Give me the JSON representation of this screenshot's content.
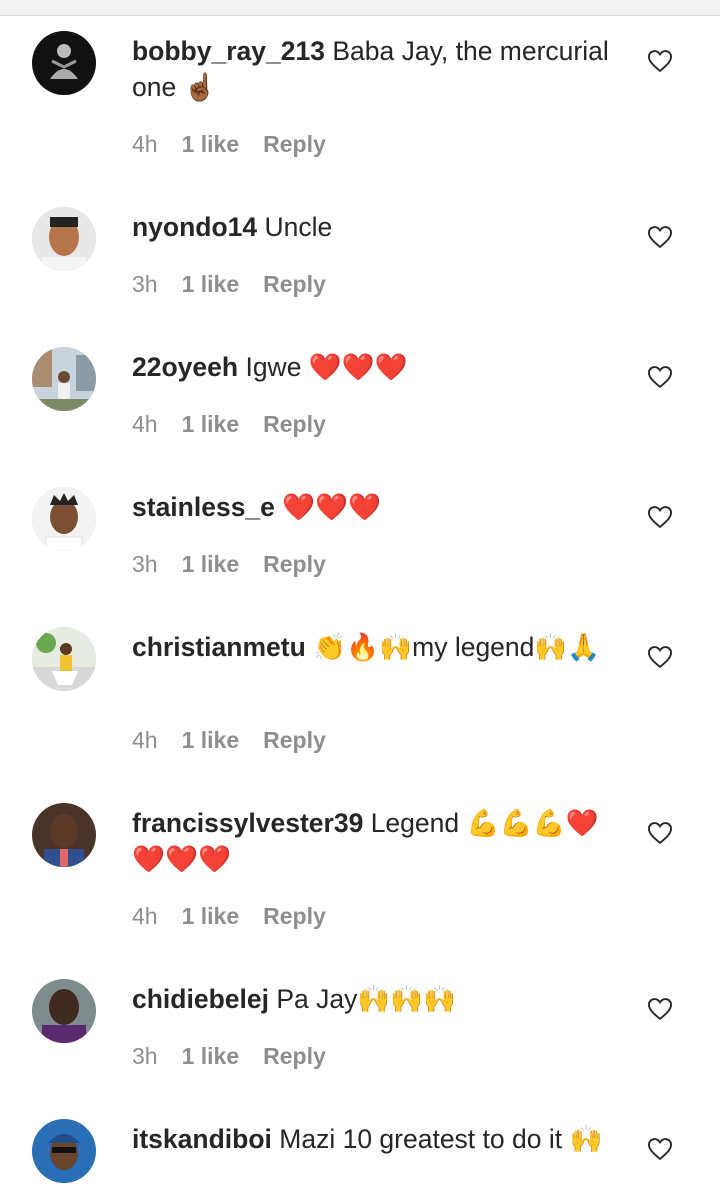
{
  "comments": [
    {
      "username": "bobby_ray_213",
      "text": "Baba Jay, the mercurial one ☝🏾",
      "time": "4h",
      "likes": "1 like",
      "reply": "Reply"
    },
    {
      "username": "nyondo14",
      "text": "Uncle",
      "time": "3h",
      "likes": "1 like",
      "reply": "Reply"
    },
    {
      "username": "22oyeeh",
      "text": "Igwe ❤️❤️❤️",
      "time": "4h",
      "likes": "1 like",
      "reply": "Reply"
    },
    {
      "username": "stainless_e",
      "text": "❤️❤️❤️",
      "time": "3h",
      "likes": "1 like",
      "reply": "Reply"
    },
    {
      "username": "christianmetu",
      "text": "👏🔥🙌my legend🙌🙏",
      "time": "4h",
      "likes": "1 like",
      "reply": "Reply"
    },
    {
      "username": "francissylvester39",
      "text": "Legend 💪💪💪❤️❤️❤️❤️",
      "time": "4h",
      "likes": "1 like",
      "reply": "Reply"
    },
    {
      "username": "chidiebelej",
      "text": "Pa Jay🙌🙌🙌",
      "time": "3h",
      "likes": "1 like",
      "reply": "Reply"
    },
    {
      "username": "itskandiboi",
      "text": "Mazi 10 greatest to do it 🙌",
      "time": "",
      "likes": "",
      "reply": ""
    }
  ],
  "icons": {
    "like": "heart-outline-icon"
  },
  "colors": {
    "text": "#262626",
    "meta": "#8e8e8e",
    "background": "#ffffff"
  }
}
